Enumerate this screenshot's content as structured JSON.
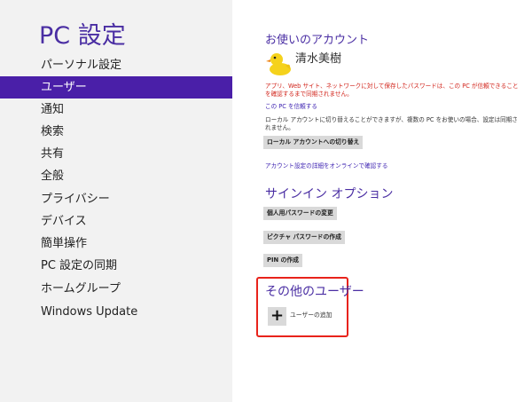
{
  "app": {
    "title": "PC 設定"
  },
  "sidebar": {
    "items": [
      {
        "label": "パーソナル設定",
        "selected": false
      },
      {
        "label": "ユーザー",
        "selected": true
      },
      {
        "label": "通知",
        "selected": false
      },
      {
        "label": "検索",
        "selected": false
      },
      {
        "label": "共有",
        "selected": false
      },
      {
        "label": "全般",
        "selected": false
      },
      {
        "label": "プライバシー",
        "selected": false
      },
      {
        "label": "デバイス",
        "selected": false
      },
      {
        "label": "簡単操作",
        "selected": false
      },
      {
        "label": "PC 設定の同期",
        "selected": false
      },
      {
        "label": "ホームグループ",
        "selected": false
      },
      {
        "label": "Windows Update",
        "selected": false
      }
    ]
  },
  "account": {
    "section_title": "お使いのアカウント",
    "name": "清水美樹",
    "avatar_icon": "duck-avatar",
    "warning": "アプリ、Web サイト、ネットワークに対して保存したパスワードは、この PC が信頼できることを確認するまで同期されません。",
    "trust_link": "この PC を信頼する",
    "local_info": "ローカル アカウントに切り替えることができますが、複数の PC をお使いの場合、設定は同期されません。",
    "switch_button": "ローカル アカウントへの切り替え",
    "online_link": "アカウント設定の詳細をオンラインで確認する"
  },
  "signin": {
    "section_title": "サインイン オプション",
    "change_password_button": "個人用パスワードの変更",
    "picture_password_button": "ピクチャ パスワードの作成",
    "pin_button": "PIN の作成"
  },
  "other_users": {
    "section_title": "その他のユーザー",
    "add_icon": "plus-icon",
    "add_label": "ユーザーの追加"
  },
  "colors": {
    "accent": "#4a2ea3",
    "selection": "#4a1fa8",
    "warning": "#d2241b",
    "highlight": "#e8231b"
  }
}
